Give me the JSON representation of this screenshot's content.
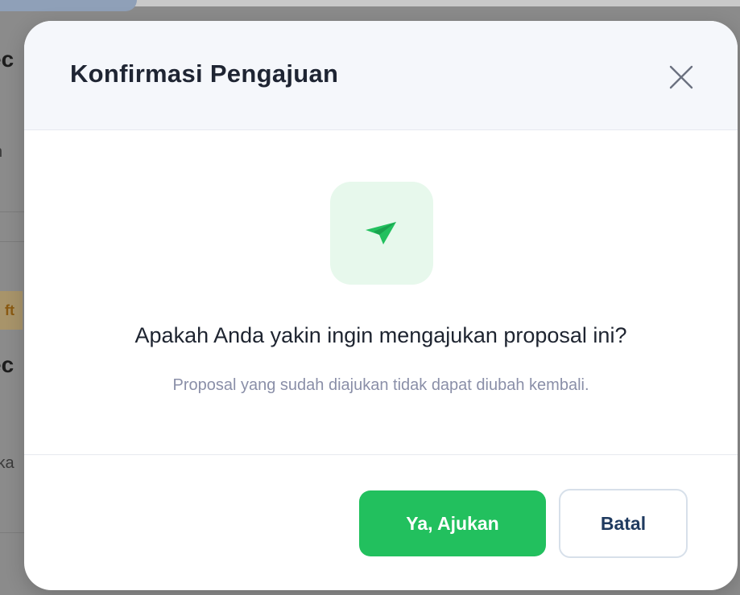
{
  "background": {
    "heading_fragment_1": "ec",
    "text_fragment_1": "n",
    "badge_fragment": "ft",
    "heading_fragment_2": "ec",
    "text_fragment_2": "ika"
  },
  "modal": {
    "title": "Konfirmasi Pengajuan",
    "close_icon": "close-icon",
    "icon": "send-paper-plane-icon",
    "question": "Apakah Anda yakin ingin mengajukan proposal ini?",
    "note": "Proposal yang sudah diajukan tidak dapat diubah kembali.",
    "confirm_label": "Ya, Ajukan",
    "cancel_label": "Batal"
  },
  "colors": {
    "accent_green": "#22c05e",
    "icon_bg": "#e7f8ec",
    "header_bg": "#f5f7fb",
    "cancel_text": "#1f3a5f"
  }
}
